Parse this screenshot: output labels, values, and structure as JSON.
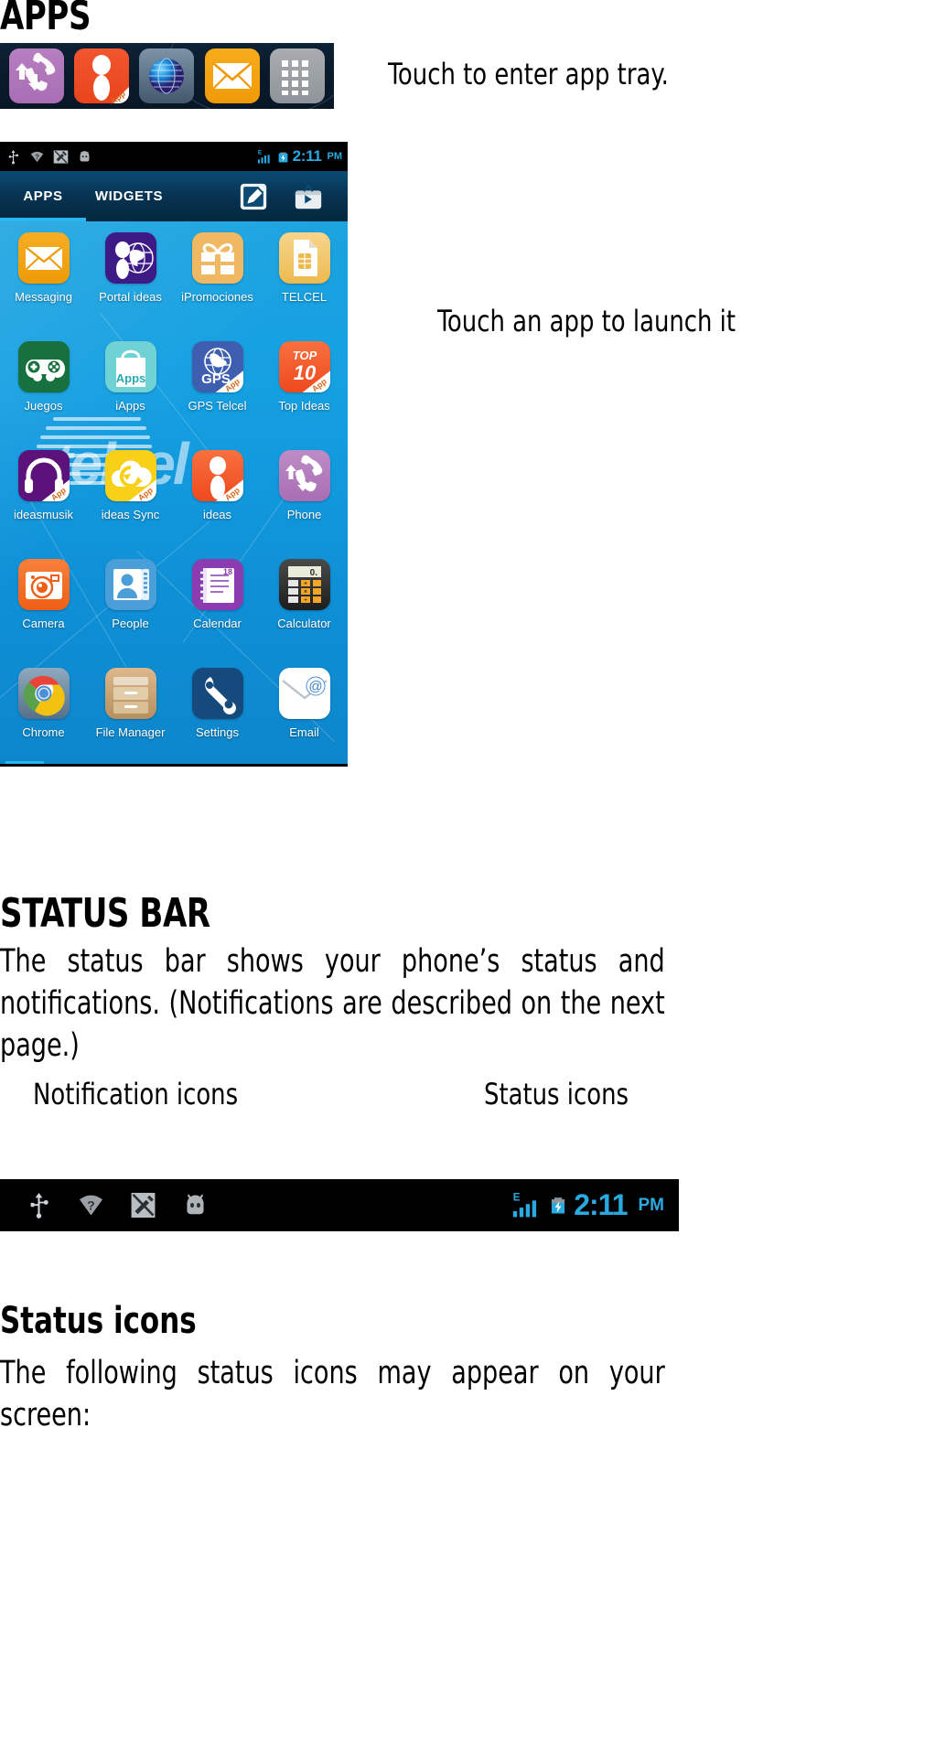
{
  "document": {
    "apps_title": "APPS",
    "callout_tray": "Touch to enter app tray.",
    "callout_launch": "Touch an app to launch it",
    "status_bar_heading": "STATUS BAR",
    "status_bar_paragraph": "The status bar shows your phone’s status and notifications. (Notifications are described on the next page.)",
    "label_notification_icons": "Notification icons",
    "label_status_icons": "Status icons",
    "status_icons_heading": "Status icons",
    "status_icons_paragraph": "The following status icons may appear on your screen:"
  },
  "dock": {
    "items": [
      {
        "name": "phone-icon",
        "label": "Phone",
        "color": "#b07ab9"
      },
      {
        "name": "ideas-icon",
        "label": "ideas",
        "color": "#ef4f26"
      },
      {
        "name": "browser-icon",
        "label": "Browser",
        "color": "#5a7085"
      },
      {
        "name": "email-icon",
        "label": "Email",
        "color": "#f5a310"
      },
      {
        "name": "app-tray-icon",
        "label": "Apps",
        "color": "#9ba0a6"
      }
    ]
  },
  "phone": {
    "statusbar": {
      "notification_icons": [
        "usb-icon",
        "wifi-question-icon",
        "vibrate-off-icon",
        "android-robot-icon"
      ],
      "network_type": "E",
      "signal_icon": "signal-bars-icon",
      "battery_icon": "battery-charging-icon",
      "time": "2:11",
      "ampm": "PM"
    },
    "tabs": [
      {
        "label": "APPS",
        "selected": true
      },
      {
        "label": "WIDGETS",
        "selected": false
      }
    ],
    "tab_actions": [
      "edit-icon",
      "play-store-icon"
    ],
    "watermark": "telcel",
    "app_grid": [
      [
        {
          "label": "Messaging",
          "icon": "envelope-icon",
          "color": "#f5a31c",
          "badge": ""
        },
        {
          "label": "Portal ideas",
          "icon": "globe-people-icon",
          "color": "#3d1a86",
          "badge": ""
        },
        {
          "label": "iPromociones",
          "icon": "gift-icon",
          "color": "#f0b862",
          "badge": ""
        },
        {
          "label": "TELCEL",
          "icon": "sim-card-icon",
          "color": "#f0c05a",
          "badge": ""
        }
      ],
      [
        {
          "label": "Juegos",
          "icon": "gamepad-icon",
          "color": "#17713f",
          "badge": ""
        },
        {
          "label": "iApps",
          "icon": "shopping-bag-icon",
          "color": "#6fd3d6",
          "badge": ""
        },
        {
          "label": "GPS Telcel",
          "icon": "gps-globe-icon",
          "color": "#3e5fb0",
          "badge": "App"
        },
        {
          "label": "Top Ideas",
          "icon": "top-ten-icon",
          "color": "#f4562b",
          "badge": "App"
        }
      ],
      [
        {
          "label": "ideasmusik",
          "icon": "headphones-icon",
          "color": "#5b127a",
          "badge": "App"
        },
        {
          "label": "ideas Sync",
          "icon": "cloud-sync-icon",
          "color": "#f8d018",
          "badge": "App"
        },
        {
          "label": "ideas",
          "icon": "ideas-person-icon",
          "color": "#f4562b",
          "badge": "App"
        },
        {
          "label": "Phone",
          "icon": "handset-icon",
          "color": "#b07ab9",
          "badge": ""
        }
      ],
      [
        {
          "label": "Camera",
          "icon": "camera-icon",
          "color": "#f26a21",
          "badge": ""
        },
        {
          "label": "People",
          "icon": "contact-card-icon",
          "color": "#4a9fd8",
          "badge": ""
        },
        {
          "label": "Calendar",
          "icon": "calendar-icon",
          "color": "#8a3cb0",
          "badge": ""
        },
        {
          "label": "Calculator",
          "icon": "calculator-icon",
          "color": "#2b2b2b",
          "badge": ""
        }
      ],
      [
        {
          "label": "Chrome",
          "icon": "chrome-icon",
          "color": "#6d8ba4",
          "badge": ""
        },
        {
          "label": "File Manager",
          "icon": "file-drawer-icon",
          "color": "#c29a6d",
          "badge": ""
        },
        {
          "label": "Settings",
          "icon": "wrench-icon",
          "color": "#174a7c",
          "badge": ""
        },
        {
          "label": "Email",
          "icon": "email-at-icon",
          "color": "#ffffff",
          "badge": ""
        }
      ]
    ]
  },
  "figure_statusbar": {
    "notification_icons": [
      "usb-icon",
      "wifi-question-icon",
      "vibrate-off-icon",
      "android-robot-icon"
    ],
    "network_type": "E",
    "time": "2:11",
    "ampm": "PM"
  },
  "colors": {
    "accent_blue": "#2aa9e0",
    "screen_blue": "#12a0e0",
    "black": "#000000"
  }
}
